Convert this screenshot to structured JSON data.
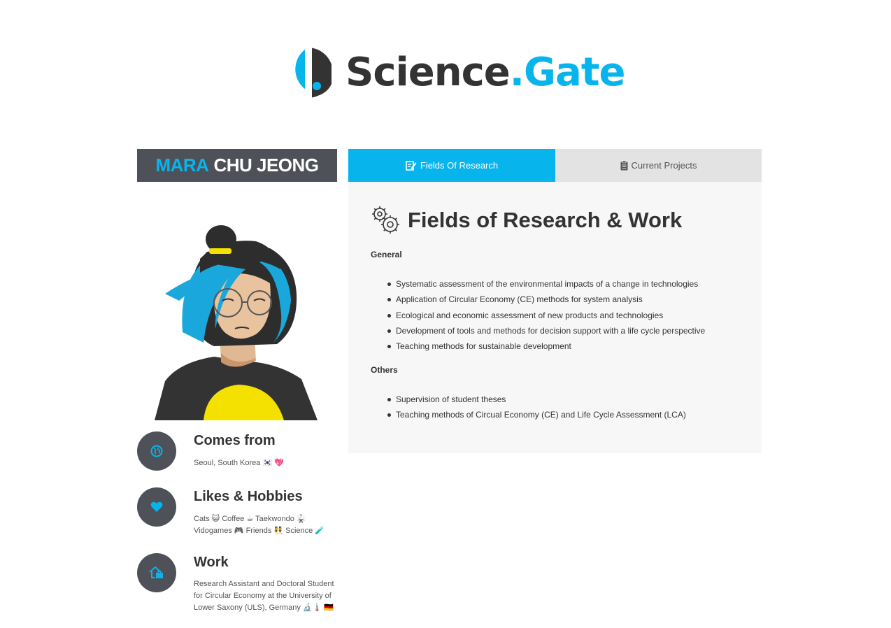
{
  "brand": {
    "name_part1": "Science",
    "name_part2": ".Gate",
    "accent_color": "#08b4ec",
    "dark_color": "#333333"
  },
  "profile": {
    "first_name": "MARA",
    "last_name": "CHU JEONG",
    "avatar_icon": "illustrated-portrait"
  },
  "info": [
    {
      "icon": "globe-icon",
      "title": "Comes from",
      "text": "Seoul, South Korea 🇰🇷 💖"
    },
    {
      "icon": "heart-icon",
      "title": "Likes & Hobbies",
      "lines": [
        "Cats 😺 Coffee ☕ Taekwondo 🥋",
        "Vidogames 🎮 Friends 👯 Science 🧪"
      ]
    },
    {
      "icon": "home-work-icon",
      "title": "Work",
      "lines": [
        "Research Assistant and Doctoral Student",
        "for Circular Economy at the University of",
        "Lower Saxony (ULS), Germany 🔬🌡️ 🇩🇪"
      ]
    }
  ],
  "tabs": [
    {
      "label": "Fields Of Research",
      "icon": "edit-icon",
      "active": true
    },
    {
      "label": "Current Projects",
      "icon": "clipboard-icon",
      "active": false
    }
  ],
  "panel": {
    "title": "Fields of Research & Work",
    "title_icon": "gears-icon",
    "sections": [
      {
        "label": "General",
        "items": [
          "Systematic assessment of the environmental impacts of a change in technologies",
          "Application of Circular Economy (CE) methods for system analysis",
          "Ecological and economic assessment of new products and technologies",
          "Development of tools and methods for decision support with a life cycle perspective",
          "Teaching methods for sustainable development"
        ]
      },
      {
        "label": "Others",
        "items": [
          "Supervision of student theses",
          "Teaching methods of Circual Economy (CE) and Life Cycle Assessment (LCA)"
        ]
      }
    ]
  }
}
